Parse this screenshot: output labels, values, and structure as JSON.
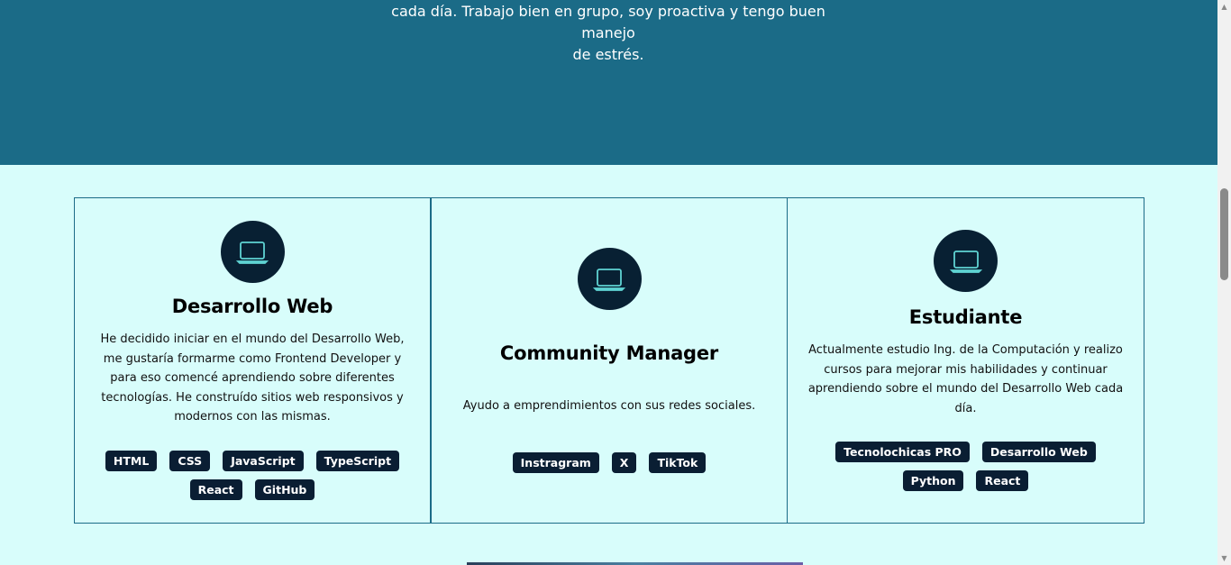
{
  "hero": {
    "text_line1": "cada día. Trabajo bien en grupo, soy proactiva y tengo buen manejo",
    "text_line2": "de estrés."
  },
  "cards": [
    {
      "icon": "laptop-icon",
      "title": "Desarrollo Web",
      "description": "He decidido iniciar en el mundo del Desarrollo Web, me gustaría formarme como Frontend Developer y para eso comencé aprendiendo sobre diferentes tecnologías. He construído sitios web responsivos y modernos con las mismas.",
      "tags": [
        "HTML",
        "CSS",
        "JavaScript",
        "TypeScript",
        "React",
        "GitHub"
      ]
    },
    {
      "icon": "laptop-icon",
      "title": "Community Manager",
      "description": "Ayudo a emprendimientos con sus redes sociales.",
      "tags": [
        "Instragram",
        "X",
        "TikTok"
      ]
    },
    {
      "icon": "laptop-icon",
      "title": "Estudiante",
      "description": "Actualmente estudio Ing. de la Computación y realizo cursos para mejorar mis habilidades y continuar aprendiendo sobre el mundo del Desarrollo Web cada día.",
      "tags": [
        "Tecnolochicas PRO",
        "Desarrollo Web",
        "Python",
        "React"
      ]
    }
  ],
  "colors": {
    "hero_bg": "#1b6b87",
    "page_bg": "#d8fdfb",
    "icon_circle": "#082033",
    "icon_stroke": "#5fd3d3",
    "tag_bg": "#0a1e33"
  }
}
